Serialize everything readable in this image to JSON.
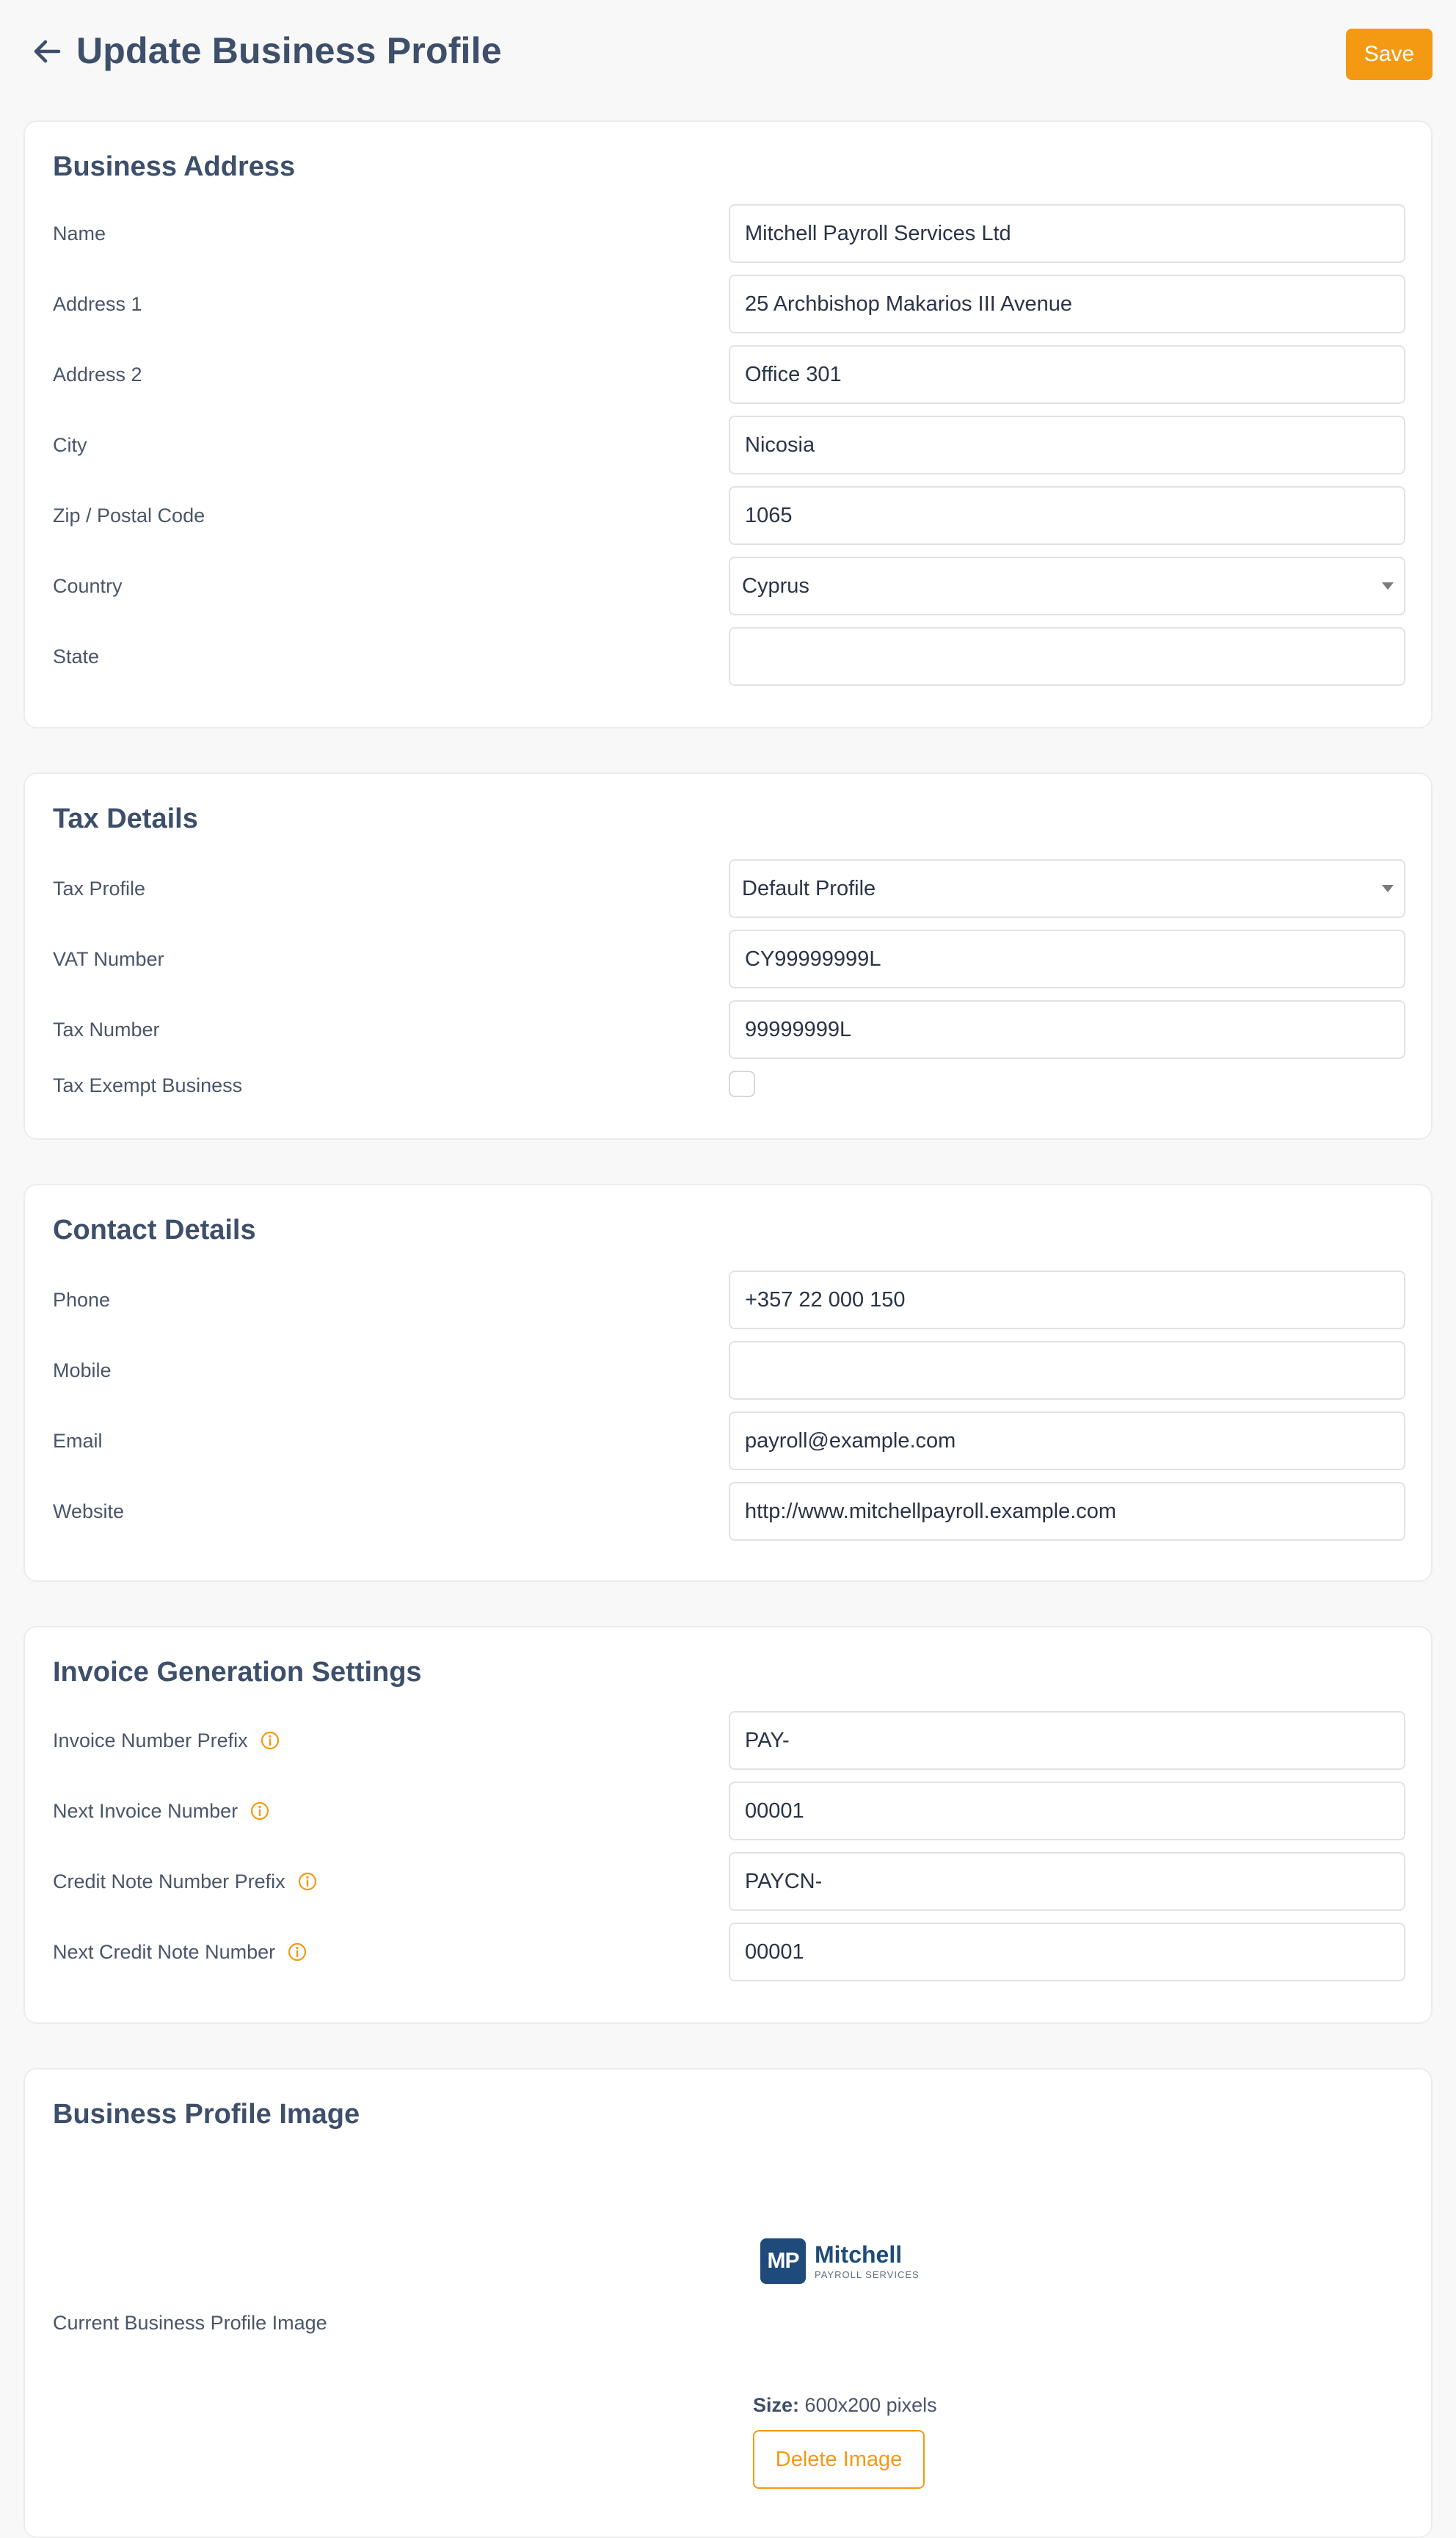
{
  "header": {
    "title": "Update Business Profile",
    "save_label": "Save"
  },
  "business_address": {
    "title": "Business Address",
    "name_label": "Name",
    "name_value": "Mitchell Payroll Services Ltd",
    "address1_label": "Address 1",
    "address1_value": "25 Archbishop Makarios III Avenue",
    "address2_label": "Address 2",
    "address2_value": "Office 301",
    "city_label": "City",
    "city_value": "Nicosia",
    "zip_label": "Zip / Postal Code",
    "zip_value": "1065",
    "country_label": "Country",
    "country_value": "Cyprus",
    "state_label": "State",
    "state_value": ""
  },
  "tax_details": {
    "title": "Tax Details",
    "tax_profile_label": "Tax Profile",
    "tax_profile_value": "Default Profile",
    "vat_label": "VAT Number",
    "vat_value": "CY99999999L",
    "tax_number_label": "Tax Number",
    "tax_number_value": "99999999L",
    "tax_exempt_label": "Tax Exempt Business",
    "tax_exempt_checked": false
  },
  "contact_details": {
    "title": "Contact Details",
    "phone_label": "Phone",
    "phone_value": "+357 22 000 150",
    "mobile_label": "Mobile",
    "mobile_value": "",
    "email_label": "Email",
    "email_value": "payroll@example.com",
    "website_label": "Website",
    "website_value": "http://www.mitchellpayroll.example.com"
  },
  "invoice_settings": {
    "title": "Invoice Generation Settings",
    "invoice_prefix_label": "Invoice Number Prefix",
    "invoice_prefix_value": "PAY-",
    "next_invoice_label": "Next Invoice Number",
    "next_invoice_value": "00001",
    "credit_prefix_label": "Credit Note Number Prefix",
    "credit_prefix_value": "PAYCN-",
    "next_credit_label": "Next Credit Note Number",
    "next_credit_value": "00001"
  },
  "profile_image": {
    "title": "Business Profile Image",
    "current_label": "Current Business Profile Image",
    "logo_initials": "MP",
    "logo_name": "Mitchell",
    "logo_sub": "PAYROLL SERVICES",
    "size_label": "Size:",
    "size_value": "600x200 pixels",
    "delete_label": "Delete Image"
  },
  "colors": {
    "accent": "#f39a12",
    "heading": "#3d4f6a",
    "logo_blue": "#1f4b7a"
  },
  "icons": {
    "back": "arrow-left-icon",
    "info": "info-circle-icon",
    "caret": "chevron-down-icon"
  }
}
